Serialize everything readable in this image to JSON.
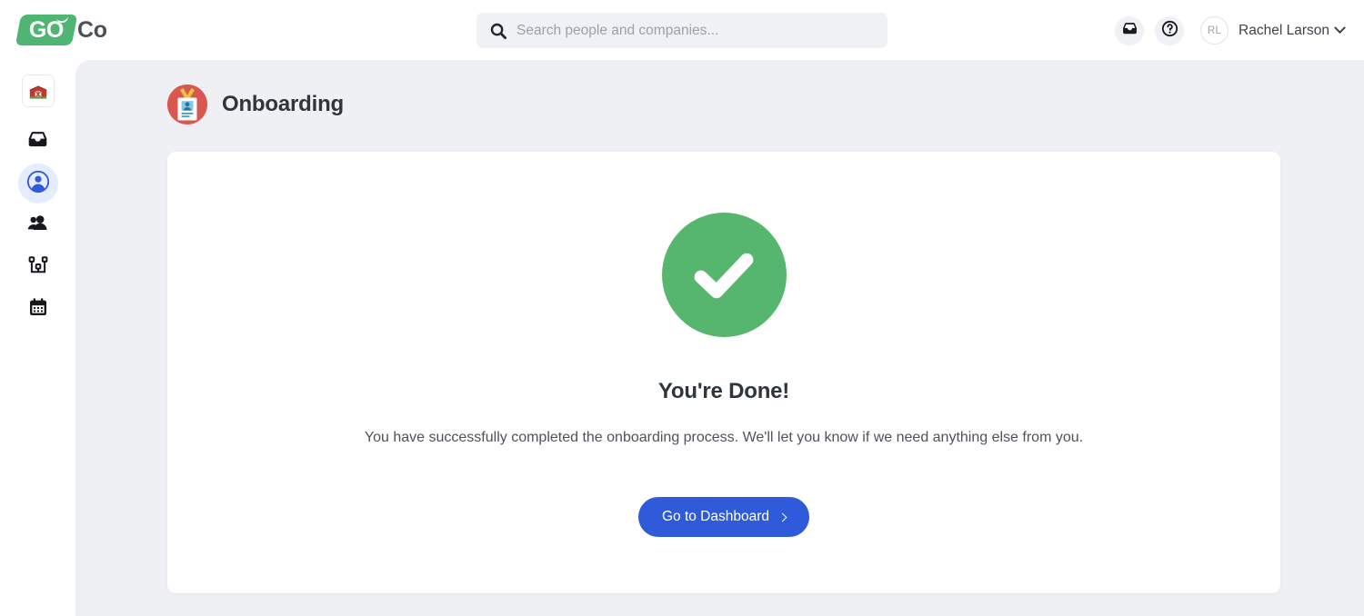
{
  "brand": {
    "logo_primary": "GO",
    "logo_secondary": "Co",
    "green": "#4fb573",
    "blue": "#2f5ad9"
  },
  "search": {
    "placeholder": "Search people and companies...",
    "value": "",
    "icon": "search-icon"
  },
  "topbar": {
    "inbox_icon": "inbox-icon",
    "help_icon": "help-circle-icon",
    "avatar_initials": "RL",
    "user_name": "Rachel Larson",
    "chevron_icon": "chevron-down-icon"
  },
  "sidebar": {
    "items": [
      {
        "id": "company",
        "label": "Company",
        "icon": "barn-icon",
        "active": false
      },
      {
        "id": "inbox",
        "label": "Inbox",
        "icon": "inbox-icon",
        "active": false
      },
      {
        "id": "profile",
        "label": "Profile",
        "icon": "person-circle-icon",
        "active": true
      },
      {
        "id": "team",
        "label": "Team",
        "icon": "people-icon",
        "active": false
      },
      {
        "id": "orgchart",
        "label": "Org Chart",
        "icon": "org-chart-icon",
        "active": false
      },
      {
        "id": "calendar",
        "label": "Calendar",
        "icon": "calendar-icon",
        "active": false
      }
    ]
  },
  "page": {
    "title": "Onboarding",
    "icon": "id-badge-icon",
    "icon_bg": "#d9574f"
  },
  "card": {
    "status_icon": "check-circle-icon",
    "status_color": "#56b66e",
    "heading": "You're Done!",
    "body": "You have successfully completed the onboarding process. We'll let you know if we need anything else from you.",
    "cta_label": "Go to Dashboard",
    "cta_icon": "chevron-right-icon"
  }
}
